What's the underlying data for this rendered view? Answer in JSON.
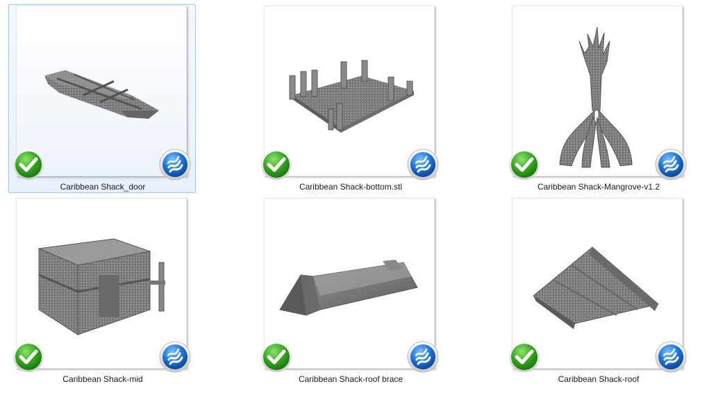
{
  "files": [
    {
      "name": "Caribbean Shack_door",
      "selected": true,
      "status_icon": "green-check-icon",
      "app_icon": "slicer-app-icon"
    },
    {
      "name": "Caribbean Shack-bottom.stl",
      "selected": false,
      "status_icon": "green-check-icon",
      "app_icon": "slicer-app-icon"
    },
    {
      "name": "Caribbean Shack-Mangrove-v1.2",
      "selected": false,
      "status_icon": "green-check-icon",
      "app_icon": "slicer-app-icon"
    },
    {
      "name": "Caribbean Shack-mid",
      "selected": false,
      "status_icon": "green-check-icon",
      "app_icon": "slicer-app-icon"
    },
    {
      "name": "Caribbean Shack-roof brace",
      "selected": false,
      "status_icon": "green-check-icon",
      "app_icon": "slicer-app-icon"
    },
    {
      "name": "Caribbean Shack-roof",
      "selected": false,
      "status_icon": "green-check-icon",
      "app_icon": "slicer-app-icon"
    }
  ],
  "colors": {
    "selection_bg": "#e8f1fc",
    "selection_border": "#99c9ef",
    "check_green": "#2e9e1a",
    "logo_blue": "#1a6fd1",
    "model_gray": "#7d7d7d"
  }
}
